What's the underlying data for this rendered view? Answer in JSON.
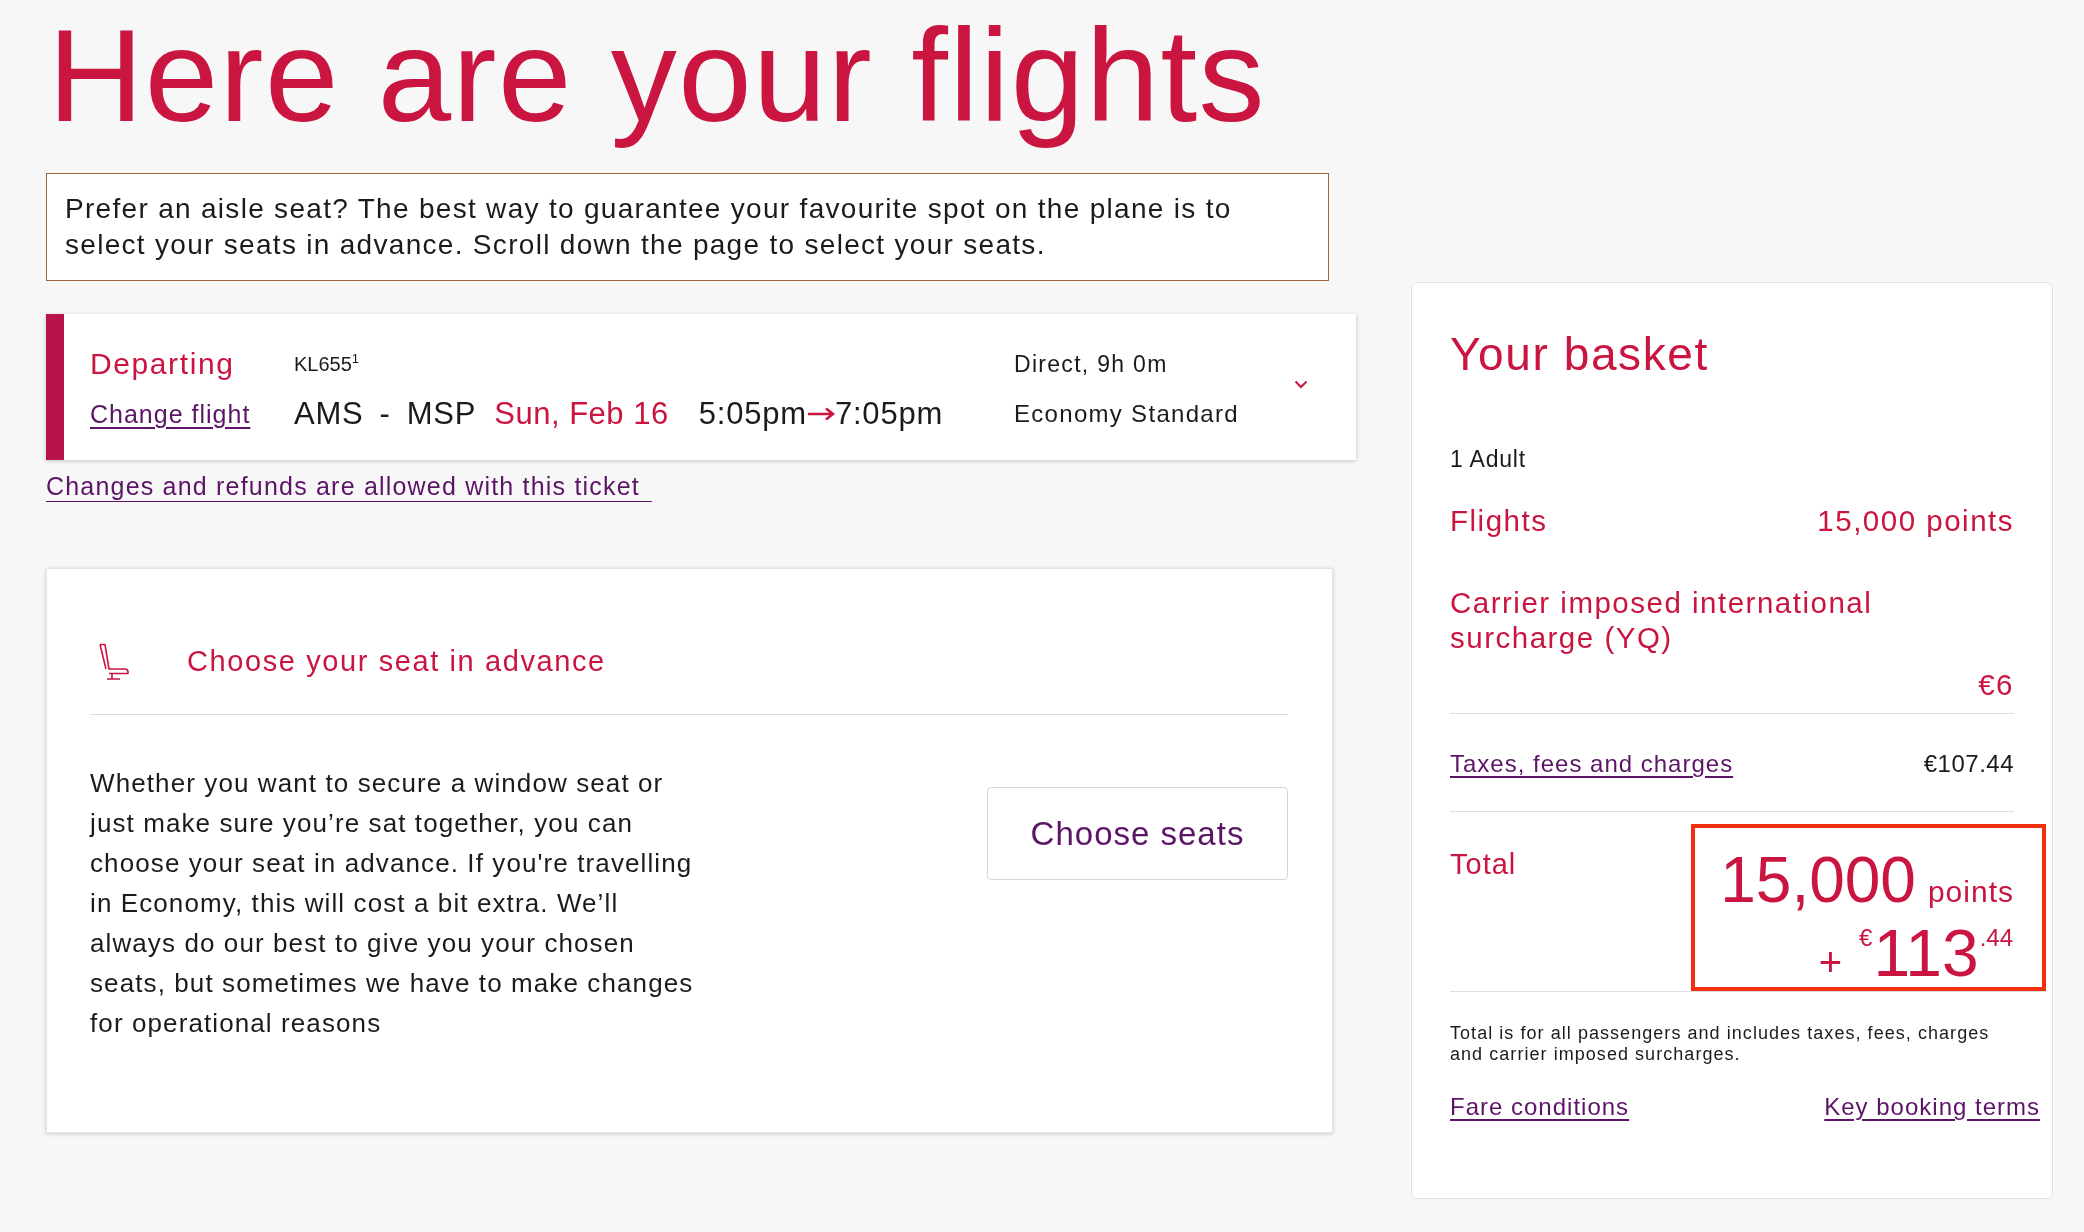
{
  "page": {
    "title": "Here are your flights"
  },
  "notice": {
    "text": "Prefer an aisle seat? The best way to guarantee your favourite spot on the plane is to select your seats in advance. Scroll down the page to select your seats."
  },
  "flight": {
    "direction": "Departing",
    "change_link": "Change flight",
    "flight_number": "KL655$^{1}$",
    "origin": "AMS",
    "separator": "-",
    "destination": "MSP",
    "date": "Sun, Feb 16",
    "departure_time": "5:05pm",
    "arrival_time": "7:05pm",
    "stops_duration": "Direct, 9h 0m",
    "cabin": "Economy Standard",
    "expanded": false
  },
  "ticket_link": "Changes and refunds are allowed with this ticket",
  "seat_section": {
    "heading": "Choose your seat in advance",
    "description": "Whether you want to secure a window seat or just make sure you’re sat together, you can choose your seat in advance. If you're travelling in Economy, this will cost a bit extra. We’ll always do our best to give you your chosen seats, but sometimes we have to make changes for operational reasons",
    "button": "Choose seats"
  },
  "basket": {
    "title": "Your basket",
    "passengers": "1 Adult",
    "lines": [
      {
        "kind": "amount",
        "label": "Flights",
        "value": "15,000 points"
      },
      {
        "kind": "stacked",
        "label": "Carrier imposed international surcharge (YQ)",
        "value": "€6"
      },
      {
        "kind": "link",
        "label": "Taxes, fees and charges",
        "value": "€107.44"
      }
    ],
    "total": {
      "label": "Total",
      "points": "15,000",
      "points_unit": "points",
      "plus": "+",
      "amount": "$^{€}$113$^{.44}$",
      "highlighted": true
    },
    "note": "Total is for all passengers and includes taxes, fees, charges and carrier imposed surcharges.",
    "links": [
      "Fare conditions",
      "Key booking terms"
    ]
  }
}
